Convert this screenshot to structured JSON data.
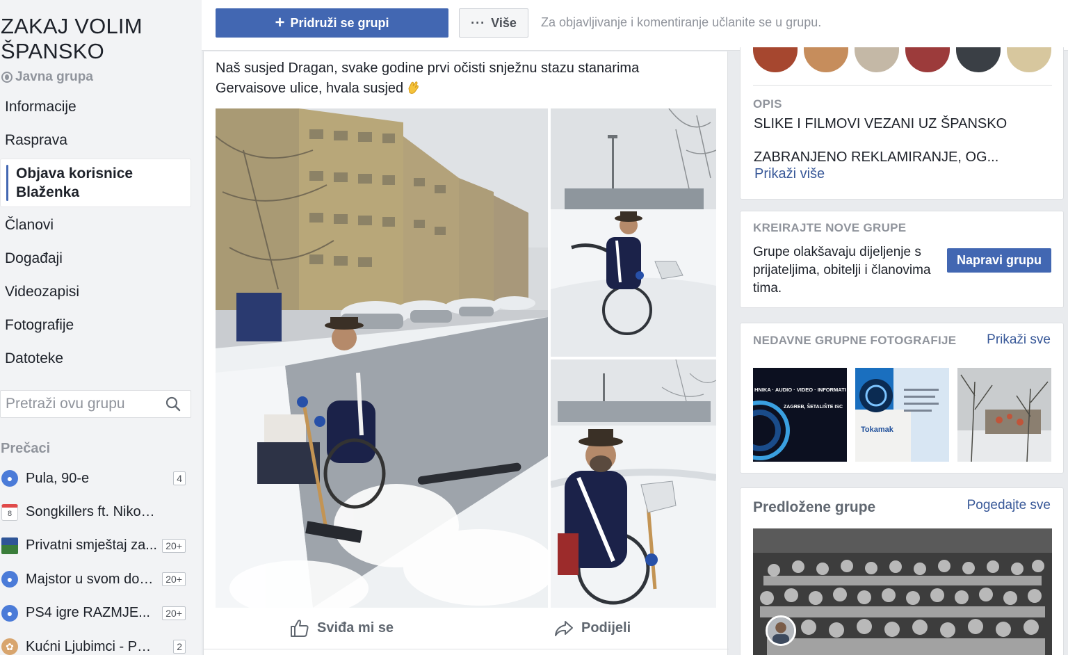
{
  "group": {
    "title_line1": "ZAKAJ VOLIM",
    "title_line2": "ŠPANSKO",
    "type": "Javna grupa"
  },
  "nav": {
    "items": [
      {
        "label": "Informacije"
      },
      {
        "label": "Rasprava"
      },
      {
        "label": "Objava korisnice Blaženka"
      },
      {
        "label": "Članovi"
      },
      {
        "label": "Događaji"
      },
      {
        "label": "Videozapisi"
      },
      {
        "label": "Fotografije"
      },
      {
        "label": "Datoteke"
      }
    ]
  },
  "search": {
    "placeholder": "Pretraži ovu grupu"
  },
  "shortcuts": {
    "title": "Prečaci",
    "items": [
      {
        "label": "Pula, 90-e",
        "badge": "4",
        "icon": "group-icon"
      },
      {
        "label": "Songkillers ft. Nikola M...",
        "badge": "",
        "icon": "calendar-icon",
        "icon_text": "8"
      },
      {
        "label": "Privatni smještaj za...",
        "badge": "20+",
        "icon": "photo-icon"
      },
      {
        "label": "Majstor u svom domu",
        "badge": "20+",
        "icon": "group-icon"
      },
      {
        "label": "PS4 igre RAZMJE...",
        "badge": "20+",
        "icon": "group-icon"
      },
      {
        "label": "Kućni Ljubimci - Port...",
        "badge": "2",
        "icon": "paw-icon"
      }
    ]
  },
  "topbar": {
    "join_label": "Pridruži se grupi",
    "more_label": "Više",
    "hint": "Za objavljivanje i komentiranje učlanite se u grupu."
  },
  "post": {
    "text": "Naš susjed Dragan, svake godine prvi očisti snježnu stazu stanarima Gervaisove ulice, hvala susjed",
    "like_label": "Sviđa mi se",
    "share_label": "Podijeli"
  },
  "right": {
    "about": {
      "title": "OPIS",
      "line1": "SLIKE I FILMOVI VEZANI UZ ŠPANSKO",
      "line2": "ZABRANJENO REKLAMIRANJE, OG...",
      "show_more": "Prikaži više"
    },
    "create": {
      "title": "KREIRAJTE NOVE GRUPE",
      "text": "Grupe olakšavaju dijeljenje s prijateljima, obitelji i članovima tima.",
      "button": "Napravi grupu"
    },
    "recent_photos": {
      "title": "NEDAVNE GRUPNE FOTOGRAFIJE",
      "link": "Prikaži sve",
      "thumb1_line1": "HNIKA · AUDIO · VIDEO · INFORMATI",
      "thumb1_line2": "ZAGREB, ŠETALIŠTE ISC",
      "thumb2_label": "Tokamak"
    },
    "suggested": {
      "title": "Predložene grupe",
      "link": "Pogedajte sve"
    }
  },
  "colors": {
    "accent": "#4267b2",
    "link": "#385898",
    "muted": "#90949c",
    "page_bg": "#e9ebee"
  }
}
